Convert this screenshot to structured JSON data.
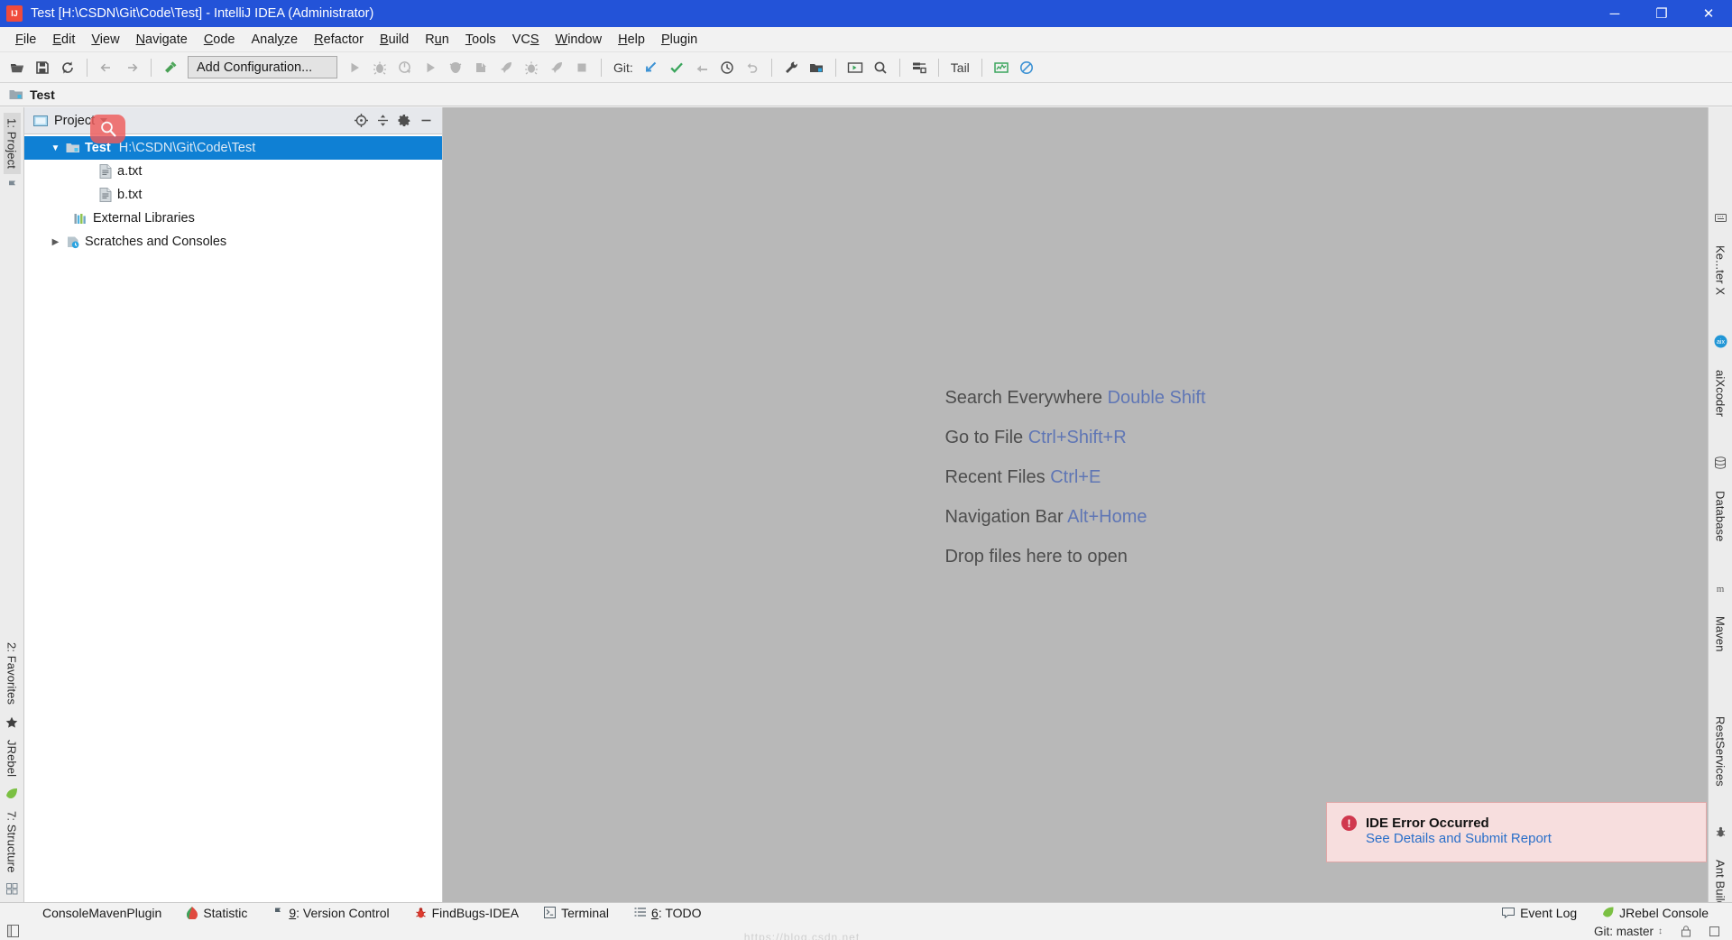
{
  "window": {
    "title": "Test [H:\\CSDN\\Git\\Code\\Test] - IntelliJ IDEA (Administrator)",
    "app_icon": "intellij-idea-icon",
    "minimize": "─",
    "maximize": "❐",
    "close": "✕",
    "titlebar_color": "#2353d8"
  },
  "menubar": {
    "items": [
      {
        "label": "File",
        "mnemonic": "F"
      },
      {
        "label": "Edit",
        "mnemonic": "E"
      },
      {
        "label": "View",
        "mnemonic": "V"
      },
      {
        "label": "Navigate",
        "mnemonic": "N"
      },
      {
        "label": "Code",
        "mnemonic": "C"
      },
      {
        "label": "Analyze",
        "mnemonic": "y"
      },
      {
        "label": "Refactor",
        "mnemonic": "R"
      },
      {
        "label": "Build",
        "mnemonic": "B"
      },
      {
        "label": "Run",
        "mnemonic": "u"
      },
      {
        "label": "Tools",
        "mnemonic": "T"
      },
      {
        "label": "VCS",
        "mnemonic": "S"
      },
      {
        "label": "Window",
        "mnemonic": "W"
      },
      {
        "label": "Help",
        "mnemonic": "H"
      },
      {
        "label": "Plugin",
        "mnemonic": "P"
      }
    ]
  },
  "toolbar": {
    "open_label": "open-folder-icon",
    "save_label": "save-all-icon",
    "sync_label": "synchronize-icon",
    "back_label": "navigate-back-icon",
    "forward_label": "navigate-forward-icon",
    "build_label": "build-hammer-icon",
    "run_config": "Add Configuration...",
    "run_label": "run-icon",
    "debug_label": "debug-icon",
    "run_coverage_label": "run-with-coverage-icon",
    "run2_label": "run-icon-2",
    "profile_label": "profile-icon",
    "attach_label": "attach-debugger-icon",
    "rocket1_label": "rocket-icon-1",
    "bug_label": "bug-icon",
    "rocket2_label": "rocket-icon-2",
    "stop_label": "stop-icon",
    "git_label": "Git:",
    "git_update_label": "update-project-icon",
    "git_commit_label": "commit-icon",
    "git_push_label": "push-icon",
    "git_history_label": "history-icon",
    "git_rollback_label": "rollback-icon",
    "settings_label": "settings-wrench-icon",
    "project_structure_label": "project-structure-icon",
    "console_label": "console-run-icon",
    "search_label": "search-icon",
    "layout_label": "layout-icon",
    "tail_label": "Tail",
    "chart_label": "chart-monitor-icon",
    "disable_label": "disabled-circle-icon"
  },
  "navbar": {
    "project_name": "Test",
    "icon": "module-folder-icon"
  },
  "left_strip": {
    "tabs": [
      {
        "label": "1: Project",
        "selected": true,
        "name": "sidebar-tab-project"
      },
      {
        "label": "2: Favorites",
        "selected": false,
        "name": "sidebar-tab-favorites"
      },
      {
        "label": "JRebel",
        "selected": false,
        "name": "sidebar-tab-jrebel"
      },
      {
        "label": "7: Structure",
        "selected": false,
        "name": "sidebar-tab-structure"
      }
    ],
    "icons": [
      "flag-icon",
      "star-icon",
      "jrebel-leaf-icon",
      "structure-grid-icon"
    ]
  },
  "right_strip": {
    "tabs": [
      {
        "label": "Ke...ter X",
        "name": "sidebar-tab-keypromoter"
      },
      {
        "label": "aiXcoder",
        "name": "sidebar-tab-aixcoder"
      },
      {
        "label": "Database",
        "name": "sidebar-tab-database"
      },
      {
        "label": "Maven",
        "name": "sidebar-tab-maven"
      },
      {
        "label": "RestServices",
        "name": "sidebar-tab-restservices"
      },
      {
        "label": "Ant Build",
        "name": "sidebar-tab-antbuild"
      }
    ]
  },
  "project_panel": {
    "title": "Project",
    "view_mode": "Project",
    "locate_label": "locate-target-icon",
    "collapse_label": "collapse-all-icon",
    "settings_label": "panel-settings-gear-icon",
    "hide_label": "hide-panel-icon",
    "tree": [
      {
        "label": "Test",
        "path": "H:\\CSDN\\Git\\Code\\Test",
        "icon": "project-folder-icon",
        "arrow": "expanded",
        "selected": true,
        "indent": 0,
        "bold": true
      },
      {
        "label": "a.txt",
        "path": "",
        "icon": "text-file-icon",
        "arrow": "none",
        "selected": false,
        "indent": 1,
        "bold": false
      },
      {
        "label": "b.txt",
        "path": "",
        "icon": "text-file-icon",
        "arrow": "none",
        "selected": false,
        "indent": 1,
        "bold": false
      },
      {
        "label": "External Libraries",
        "path": "",
        "icon": "libraries-icon",
        "arrow": "none",
        "selected": false,
        "indent": 0,
        "bold": false
      },
      {
        "label": "Scratches and Consoles",
        "path": "",
        "icon": "scratches-icon",
        "arrow": "collapsed",
        "selected": false,
        "indent": 0,
        "bold": false
      }
    ]
  },
  "cursor": {
    "icon": "search-magnifier-cursor-icon",
    "color": "#ef5c5c"
  },
  "editor": {
    "background": "#b8b8b8",
    "hints": [
      {
        "text": "Search Everywhere",
        "key": "Double Shift"
      },
      {
        "text": "Go to File",
        "key": "Ctrl+Shift+R"
      },
      {
        "text": "Recent Files",
        "key": "Ctrl+E"
      },
      {
        "text": "Navigation Bar",
        "key": "Alt+Home"
      },
      {
        "text": "Drop files here to open",
        "key": ""
      }
    ]
  },
  "notification": {
    "badge": "!",
    "title": "IDE Error Occurred",
    "link": "See Details and Submit Report",
    "bg_color": "#f7dede",
    "border_color": "#e0a8a8",
    "badge_color": "#d0384e",
    "link_color": "#2a6fc9"
  },
  "bottom_bar": {
    "tabs": [
      {
        "label": "ConsoleMavenPlugin",
        "icon": "",
        "name": "bottom-tab-console-maven-plugin"
      },
      {
        "label": "Statistic",
        "icon": "statistic-icon",
        "name": "bottom-tab-statistic"
      },
      {
        "label": "9: Version Control",
        "icon": "version-control-icon",
        "name": "bottom-tab-version-control"
      },
      {
        "label": "FindBugs-IDEA",
        "icon": "findbugs-icon",
        "name": "bottom-tab-findbugs"
      },
      {
        "label": "Terminal",
        "icon": "terminal-icon",
        "name": "bottom-tab-terminal"
      },
      {
        "label": "6: TODO",
        "icon": "todo-list-icon",
        "name": "bottom-tab-todo"
      }
    ],
    "right_items": [
      {
        "label": "Event Log",
        "icon": "event-log-icon",
        "name": "bottom-tab-event-log"
      },
      {
        "label": "JRebel Console",
        "icon": "jrebel-icon",
        "name": "bottom-tab-jrebel-console"
      }
    ]
  },
  "status_bar": {
    "left_icon": "toggle-toolwindows-icon",
    "watermark": "https://blog.csdn.net",
    "git_branch": "Git: master",
    "lock_icon": "lock-icon",
    "memory_icon": "memory-indicator"
  }
}
